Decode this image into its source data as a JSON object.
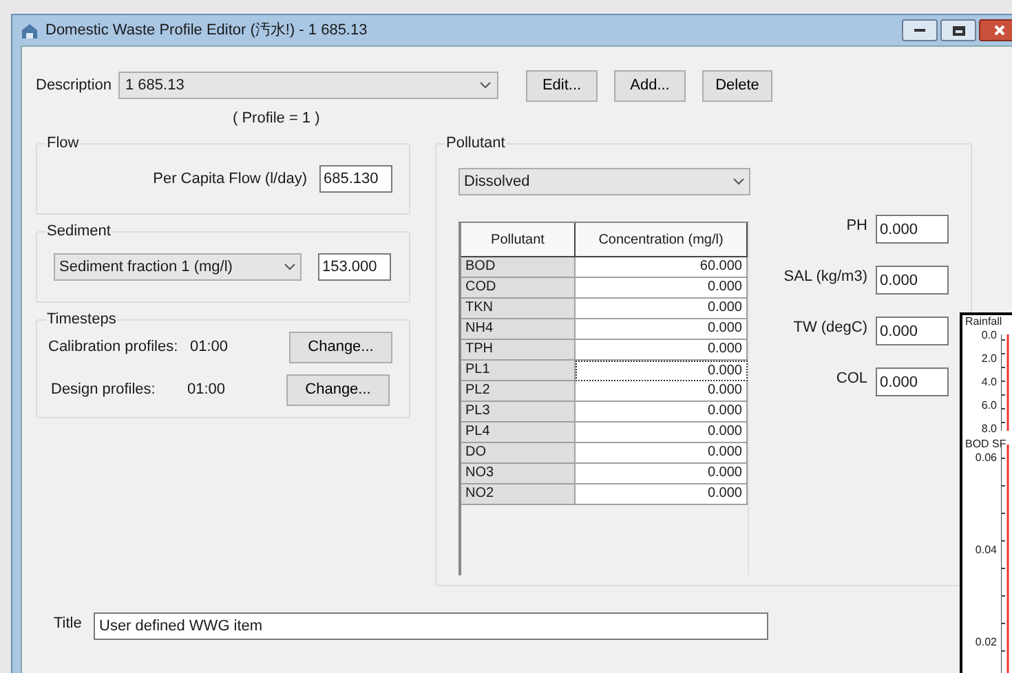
{
  "window": {
    "title": "Domestic Waste Profile Editor (汚水!) - 1 685.13"
  },
  "description": {
    "label": "Description",
    "value": "1 685.13",
    "profile_note": "( Profile = 1 )"
  },
  "buttons": [
    "Edit...",
    "Add...",
    "Delete"
  ],
  "flow": {
    "title": "Flow",
    "label": "Per Capita Flow (l/day)",
    "value": "685.130"
  },
  "sediment": {
    "title": "Sediment",
    "selection": "Sediment fraction 1 (mg/l)",
    "value": "153.000"
  },
  "timesteps": {
    "title": "Timesteps",
    "rows": [
      {
        "label": "Calibration profiles:",
        "value": "01:00",
        "button": "Change..."
      },
      {
        "label": "Design profiles:",
        "value": "01:00",
        "button": "Change..."
      }
    ]
  },
  "pollutant": {
    "title": "Pollutant",
    "selection": "Dissolved",
    "table": {
      "columns": [
        "Pollutant",
        "Concentration (mg/l)"
      ],
      "rows": [
        {
          "name": "BOD",
          "value": "60.000",
          "selected": false
        },
        {
          "name": "COD",
          "value": "0.000",
          "selected": false
        },
        {
          "name": "TKN",
          "value": "0.000",
          "selected": false
        },
        {
          "name": "NH4",
          "value": "0.000",
          "selected": false
        },
        {
          "name": "TPH",
          "value": "0.000",
          "selected": false
        },
        {
          "name": "PL1",
          "value": "0.000",
          "selected": true
        },
        {
          "name": "PL2",
          "value": "0.000",
          "selected": false
        },
        {
          "name": "PL3",
          "value": "0.000",
          "selected": false
        },
        {
          "name": "PL4",
          "value": "0.000",
          "selected": false
        },
        {
          "name": "DO",
          "value": "0.000",
          "selected": false
        },
        {
          "name": "NO3",
          "value": "0.000",
          "selected": false
        },
        {
          "name": "NO2",
          "value": "0.000",
          "selected": false
        }
      ]
    },
    "fields": [
      {
        "label": "PH",
        "value": "0.000"
      },
      {
        "label": "SAL (kg/m3)",
        "value": "0.000"
      },
      {
        "label": "TW (degC)",
        "value": "0.000"
      },
      {
        "label": "COL",
        "value": "0.000"
      }
    ]
  },
  "title_field": {
    "label": "Title",
    "value": "User defined WWG item"
  },
  "background_chart": {
    "top_label": "Rainfall",
    "top_ticks": [
      "0.0",
      "2.0",
      "4.0",
      "6.0",
      "8.0"
    ],
    "bottom_label": "BOD SF",
    "bottom_ticks": [
      "0.06",
      "0.04",
      "0.02"
    ]
  }
}
